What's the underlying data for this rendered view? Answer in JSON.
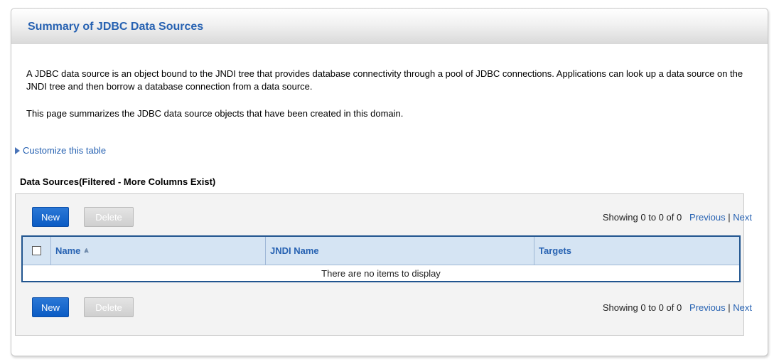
{
  "page": {
    "title": "Summary of JDBC Data Sources",
    "description_1": "A JDBC data source is an object bound to the JNDI tree that provides database connectivity through a pool of JDBC connections. Applications can look up a data source on the JNDI tree and then borrow a database connection from a data source.",
    "description_2": "This page summarizes the JDBC data source objects that have been created in this domain.",
    "customize_link": "Customize this table"
  },
  "table": {
    "title": "Data Sources(Filtered - More Columns Exist)",
    "new_label": "New",
    "delete_label": "Delete",
    "showing": "Showing 0 to 0 of 0",
    "previous": "Previous",
    "separator": "|",
    "next": "Next",
    "columns": [
      "Name",
      "JNDI Name",
      "Targets"
    ],
    "empty_message": "There are no items to display",
    "sort_indicator": "⩓"
  },
  "colors": {
    "accent": "#2762b2",
    "button_primary": "#0a5bc4",
    "header_bg": "#d5e4f3"
  }
}
